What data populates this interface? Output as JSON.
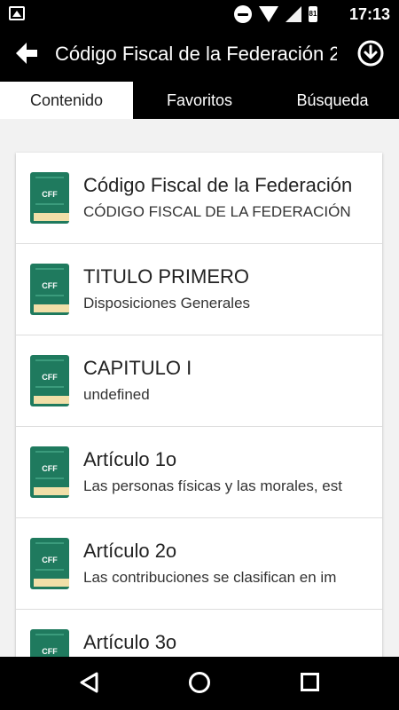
{
  "status_bar": {
    "time": "17:13",
    "battery_level": "81"
  },
  "app_bar": {
    "title": "Código Fiscal de la Federación 2"
  },
  "tabs": [
    {
      "label": "Contenido",
      "active": true
    },
    {
      "label": "Favoritos",
      "active": false
    },
    {
      "label": "Búsqueda",
      "active": false
    }
  ],
  "book_icon": {
    "label": "CFF",
    "color": "#1f7a5e"
  },
  "items": [
    {
      "title": "Código Fiscal de la Federación",
      "subtitle": "CÓDIGO FISCAL DE LA FEDERACIÓN"
    },
    {
      "title": "TITULO PRIMERO",
      "subtitle": "Disposiciones Generales"
    },
    {
      "title": "CAPITULO I",
      "subtitle": "undefined"
    },
    {
      "title": "Artículo 1o",
      "subtitle": "Las personas físicas y las morales, est"
    },
    {
      "title": "Artículo 2o",
      "subtitle": "Las contribuciones se clasifican en im"
    },
    {
      "title": "Artículo 3o",
      "subtitle": ""
    }
  ]
}
